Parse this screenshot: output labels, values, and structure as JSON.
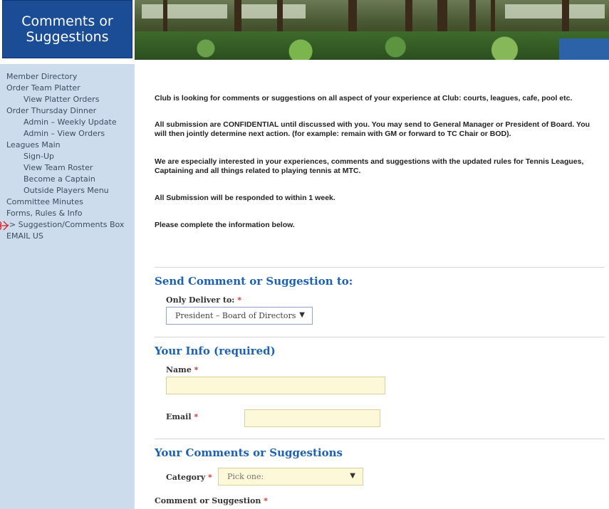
{
  "header": {
    "title": "Comments or\nSuggestions"
  },
  "sidebar": {
    "items": [
      {
        "label": "Member Directory",
        "sub": false
      },
      {
        "label": "Order Team Platter",
        "sub": false
      },
      {
        "label": "View Platter Orders",
        "sub": true
      },
      {
        "label": "Order Thursday Dinner",
        "sub": false
      },
      {
        "label": "Admin – Weekly Update",
        "sub": true
      },
      {
        "label": "Admin – View Orders",
        "sub": true
      },
      {
        "label": "Leagues Main",
        "sub": false
      },
      {
        "label": "Sign-Up",
        "sub": true
      },
      {
        "label": "View Team Roster",
        "sub": true
      },
      {
        "label": "Become a Captain",
        "sub": true
      },
      {
        "label": "Outside Players Menu",
        "sub": true
      },
      {
        "label": "Committee Minutes",
        "sub": false
      },
      {
        "label": "Forms, Rules & Info",
        "sub": false
      },
      {
        "label": "-> Suggestion/Comments Box",
        "sub": false
      },
      {
        "label": "EMAIL US",
        "sub": false
      }
    ]
  },
  "intro": {
    "p1": "Club is looking for comments or suggestions on all aspect of your experience at Club:  courts, leagues, cafe, pool etc.",
    "p2": "All submission are CONFIDENTIAL until  discussed with you.   You may send to General Manager or President of Board.  You will then jointly determine next action.  (for example: remain with GM or forward to TC Chair or BOD).",
    "p3": "We are especially interested in your experiences, comments and suggestions with the updated rules for Tennis Leagues, Captaining and all things related to playing tennis at MTC.",
    "p4": "All Submission will be responded to within 1 week.",
    "p5": "Please complete the information below."
  },
  "form": {
    "send_section": {
      "title": "Send Comment or Suggestion to:",
      "deliver_label": "Only Deliver to:",
      "deliver_value": "President – Board of Directors"
    },
    "info_section": {
      "title": "Your Info (required)",
      "name_label": "Name",
      "name_value": "",
      "email_label": "Email",
      "email_value": ""
    },
    "comments_section": {
      "title": "Your Comments or Suggestions",
      "category_label": "Category",
      "category_value": "Pick one:",
      "comment_label": "Comment or Suggestion"
    },
    "required_mark": "*"
  },
  "colors": {
    "title_bg": "#1a4d96",
    "sidebar_bg": "#cddcec",
    "section_title": "#1d62b2",
    "input_bg": "#fdf8d8",
    "annotation_arrow": "#e02020"
  }
}
